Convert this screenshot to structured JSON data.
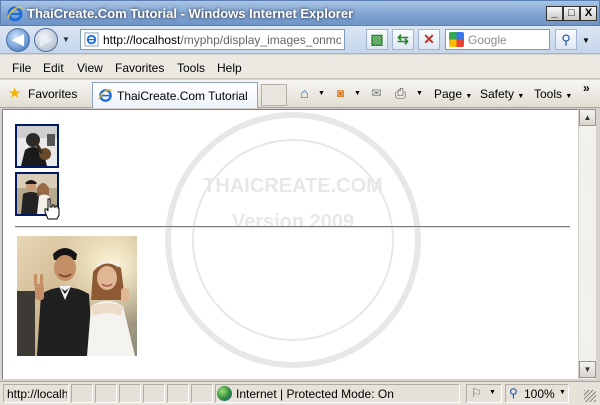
{
  "window": {
    "title": "ThaiCreate.Com Tutorial - Windows Internet Explorer",
    "minimize_glyph": "_",
    "maximize_glyph": "□",
    "close_glyph": "X"
  },
  "address_bar": {
    "url_host": "http://localhost",
    "url_path": "/myphp/display_images_onmousec"
  },
  "search": {
    "placeholder": "Google"
  },
  "menu": {
    "items": [
      "File",
      "Edit",
      "View",
      "Favorites",
      "Tools",
      "Help"
    ]
  },
  "favorites_bar": {
    "favorites_label": "Favorites",
    "tab_label": "ThaiCreate.Com Tutorial",
    "page_label": "Page",
    "safety_label": "Safety",
    "tools_label": "Tools",
    "more_glyph": "»"
  },
  "watermark": {
    "line1": "THAICREATE.COM",
    "line2": "Version 2009"
  },
  "status_bar": {
    "url_text": "http://localhost",
    "zone_text": "Internet | Protected Mode: On",
    "zoom_text": "100%"
  },
  "icons": {
    "back": "back-arrow-icon",
    "forward": "forward-arrow-icon",
    "refresh": "refresh-icon",
    "stop": "stop-icon",
    "home": "home-icon",
    "feeds": "rss-icon",
    "mail": "mail-icon",
    "print": "print-icon"
  },
  "colors": {
    "titlebar": "#7fa3d1",
    "thumb_border": "#001a66"
  }
}
